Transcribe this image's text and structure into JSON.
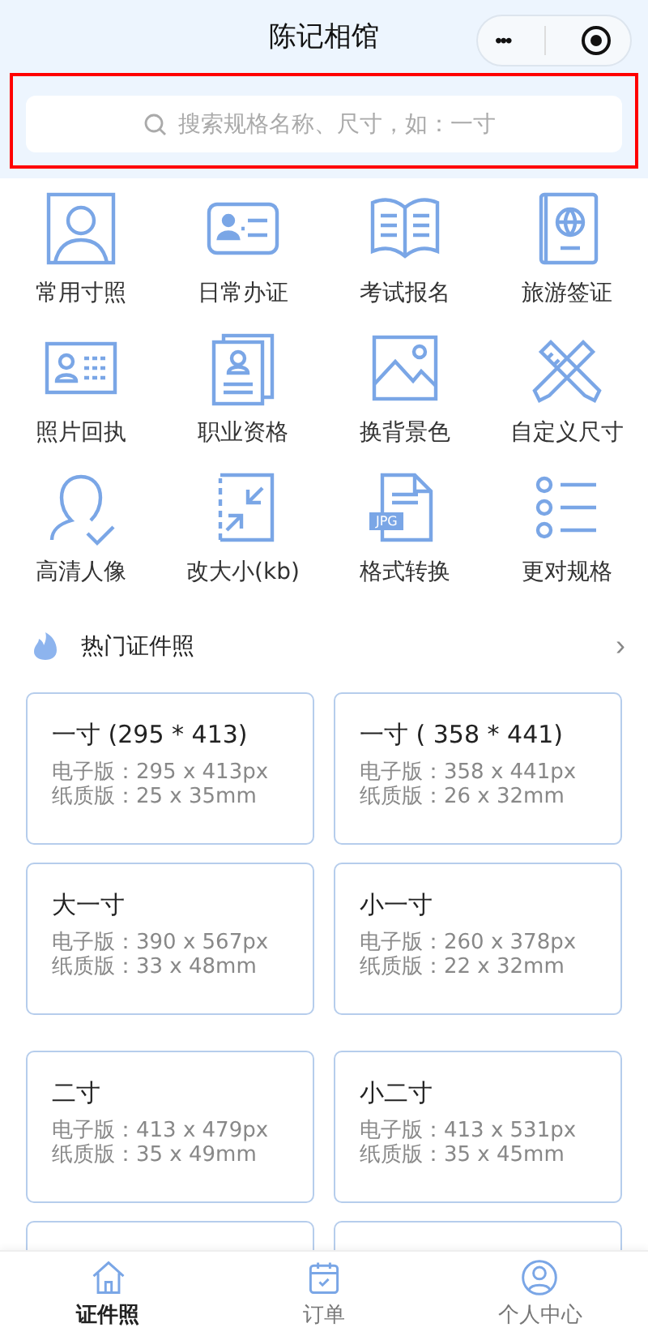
{
  "header": {
    "title": "陈记相馆",
    "menu_glyph": "•••"
  },
  "search": {
    "placeholder": "搜索规格名称、尺寸，如：一寸"
  },
  "categories": [
    {
      "label": "常用寸照"
    },
    {
      "label": "日常办证"
    },
    {
      "label": "考试报名"
    },
    {
      "label": "旅游签证"
    },
    {
      "label": "照片回执"
    },
    {
      "label": "职业资格"
    },
    {
      "label": "换背景色"
    },
    {
      "label": "自定义尺寸"
    },
    {
      "label": "高清人像"
    },
    {
      "label": "改大小(kb)"
    },
    {
      "label": "格式转换",
      "badge": "JPG"
    },
    {
      "label": "更对规格"
    }
  ],
  "section": {
    "title": "热门证件照",
    "more": "›"
  },
  "specs": [
    {
      "name": "一寸 (295 * 413)",
      "digital": "电子版：295 x 413px",
      "print": "纸质版：25 x 35mm"
    },
    {
      "name": "一寸 ( 358 * 441)",
      "digital": "电子版：358 x 441px",
      "print": "纸质版：26 x 32mm"
    },
    {
      "name": "大一寸",
      "digital": "电子版：390 x 567px",
      "print": "纸质版：33 x 48mm"
    },
    {
      "name": "小一寸",
      "digital": "电子版：260 x 378px",
      "print": "纸质版：22 x 32mm"
    },
    {
      "name": "二寸",
      "digital": "电子版：413 x 479px",
      "print": "纸质版：35 x 49mm"
    },
    {
      "name": "小二寸",
      "digital": "电子版：413 x 531px",
      "print": "纸质版：35 x 45mm"
    }
  ],
  "tabbar": [
    {
      "label": "证件照",
      "selected": true
    },
    {
      "label": "订单",
      "selected": false
    },
    {
      "label": "个人中心",
      "selected": false
    }
  ]
}
